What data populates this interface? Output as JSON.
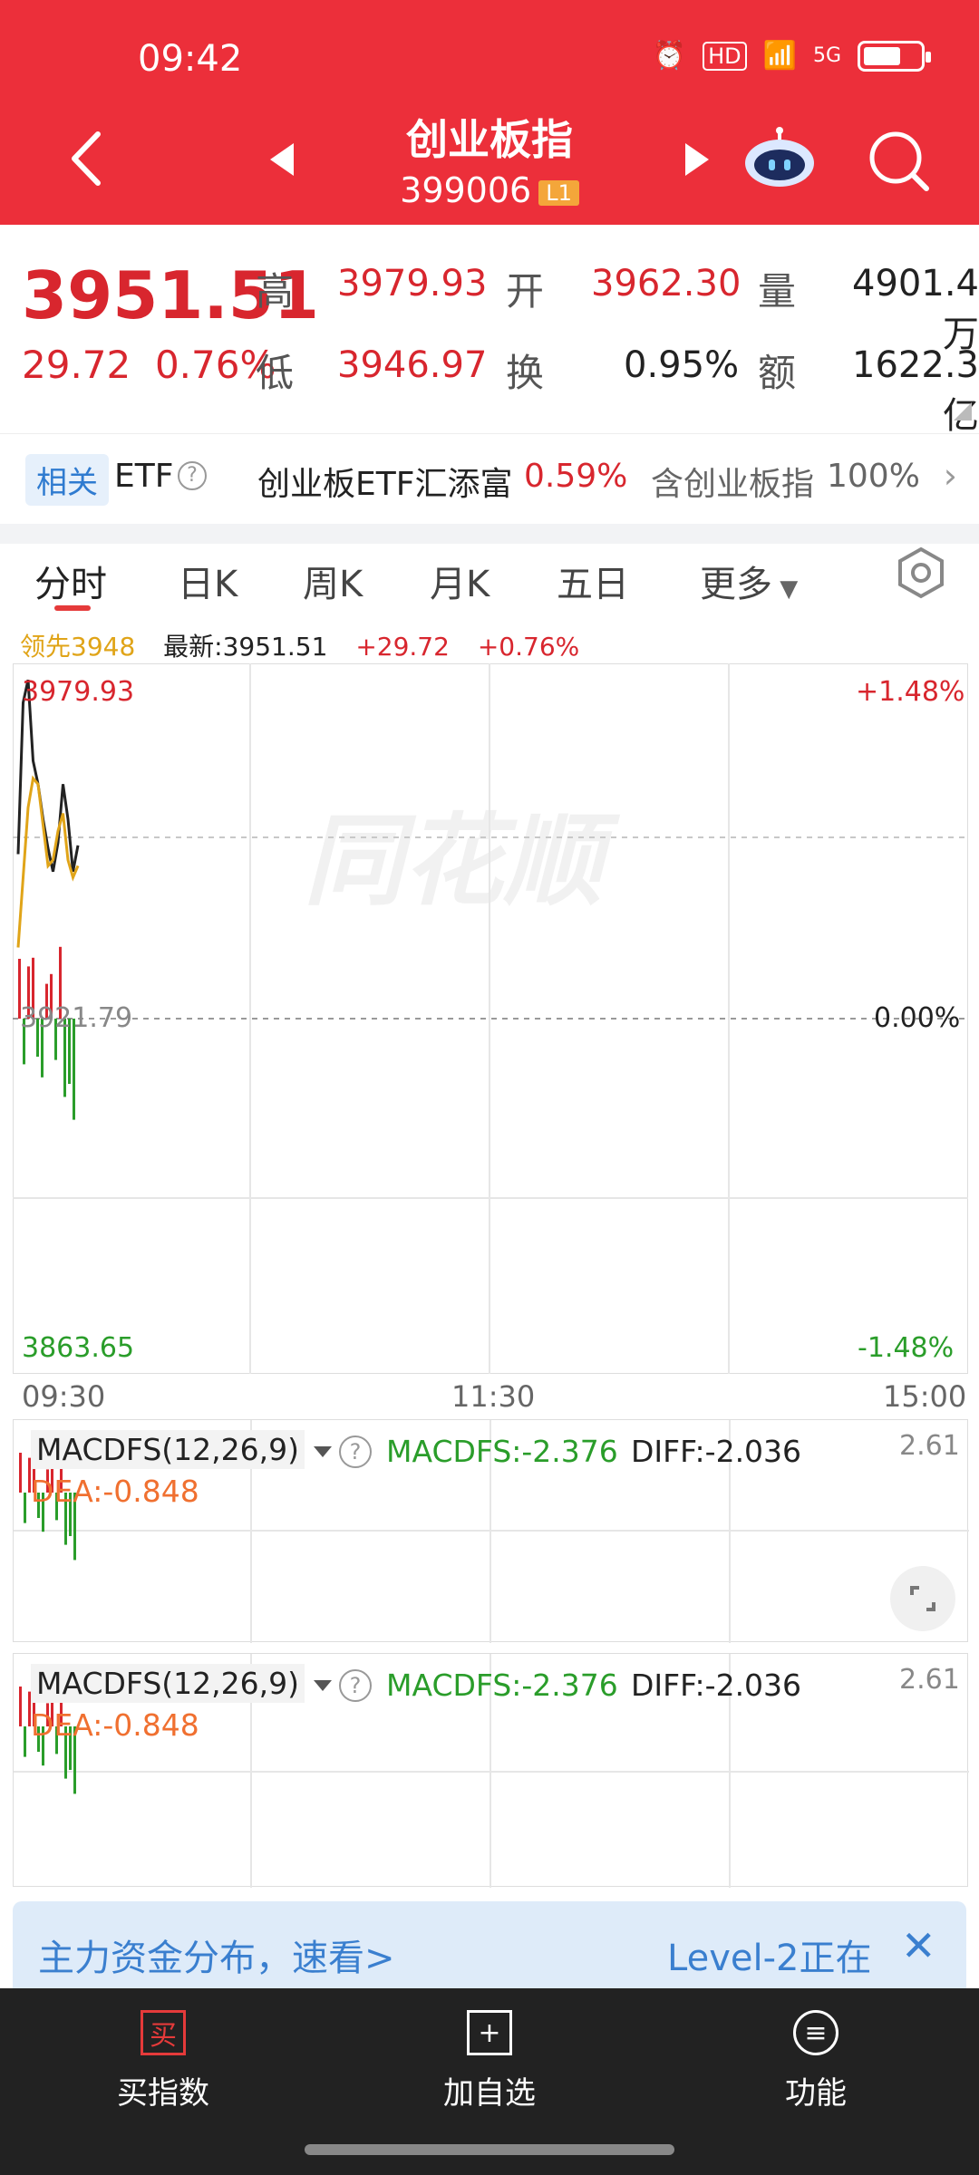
{
  "status": {
    "time": "09:42",
    "icons": [
      "alarm-icon",
      "hd-icon",
      "wifi-icon",
      "5g-signal-icon",
      "battery-icon"
    ],
    "hd": "HD",
    "net": "5G"
  },
  "header": {
    "title": "创业板指",
    "code": "399006",
    "level_badge": "L1"
  },
  "quote": {
    "price": "3951.51",
    "change": "29.72",
    "change_pct": "0.76%",
    "high_label": "高",
    "high": "3979.93",
    "low_label": "低",
    "low": "3946.97",
    "open_label": "开",
    "open": "3962.30",
    "turnover_label": "换",
    "turnover": "0.95%",
    "volume_label": "量",
    "volume": "4901.4万",
    "amount_label": "额",
    "amount": "1622.3亿"
  },
  "etf": {
    "tag": "相关",
    "label": "ETF",
    "name": "创业板ETF汇添富",
    "pct": "0.59%",
    "contains": "含创业板指",
    "weight": "100%"
  },
  "tabs": [
    "分时",
    "日K",
    "周K",
    "月K",
    "五日",
    "更多"
  ],
  "chart_info": {
    "lead": "领先3948",
    "latest": "最新:3951.51",
    "change": "+29.72",
    "pct": "+0.76%"
  },
  "chart_labels": {
    "top_price": "3979.93",
    "mid_price": "3921.79",
    "bottom_price": "3863.65",
    "top_pct": "+1.48%",
    "mid_pct": "0.00%",
    "bottom_pct": "-1.48%",
    "t_start": "09:30",
    "t_mid": "11:30",
    "t_end": "15:00",
    "watermark": "同花顺"
  },
  "chart_data": {
    "type": "line",
    "title": "",
    "xlabel": "",
    "ylabel": "",
    "ylim": [
      3863.65,
      3979.93
    ],
    "x": [
      "09:30",
      "09:31",
      "09:32",
      "09:33",
      "09:34",
      "09:35",
      "09:36",
      "09:37",
      "09:38",
      "09:39",
      "09:40",
      "09:41",
      "09:42"
    ],
    "series": [
      {
        "name": "最新",
        "values": [
          3950.0,
          3976.0,
          3979.9,
          3966.0,
          3962.0,
          3956.0,
          3951.0,
          3947.0,
          3952.0,
          3962.0,
          3956.0,
          3947.0,
          3951.5
        ]
      },
      {
        "name": "领先",
        "values": [
          3934.0,
          3946.0,
          3958.0,
          3963.0,
          3962.0,
          3955.0,
          3948.0,
          3949.0,
          3954.0,
          3957.0,
          3949.0,
          3946.0,
          3948.0
        ]
      }
    ],
    "volume_bars": [
      9,
      4,
      5,
      8,
      3,
      5,
      7,
      2,
      6,
      4,
      1,
      3,
      5
    ],
    "net_bars": [
      5.5,
      -4.2,
      4.8,
      5.6,
      -3.5,
      -5.4,
      3.2,
      4.1,
      -3.8,
      6.6,
      -7.2,
      -6.0,
      -9.3
    ]
  },
  "macd": {
    "selector": "MACDFS(12,26,9)",
    "macdfs": "MACDFS:-2.376",
    "diff": "DIFF:-2.036",
    "dea": "DEA:-0.848",
    "max": "2.61"
  },
  "banner": {
    "left": "主力资金分布，速看>",
    "right": "Level-2正在"
  },
  "bottom_bar": [
    {
      "label": "买指数",
      "icon": "买"
    },
    {
      "label": "加自选",
      "icon": "+"
    },
    {
      "label": "功能",
      "icon": "≡"
    }
  ],
  "colors": {
    "header": "#ec2f3a",
    "up": "#d8262e",
    "down": "#2a9d2a",
    "lead_line": "#e0a418",
    "price_line": "#222222"
  }
}
